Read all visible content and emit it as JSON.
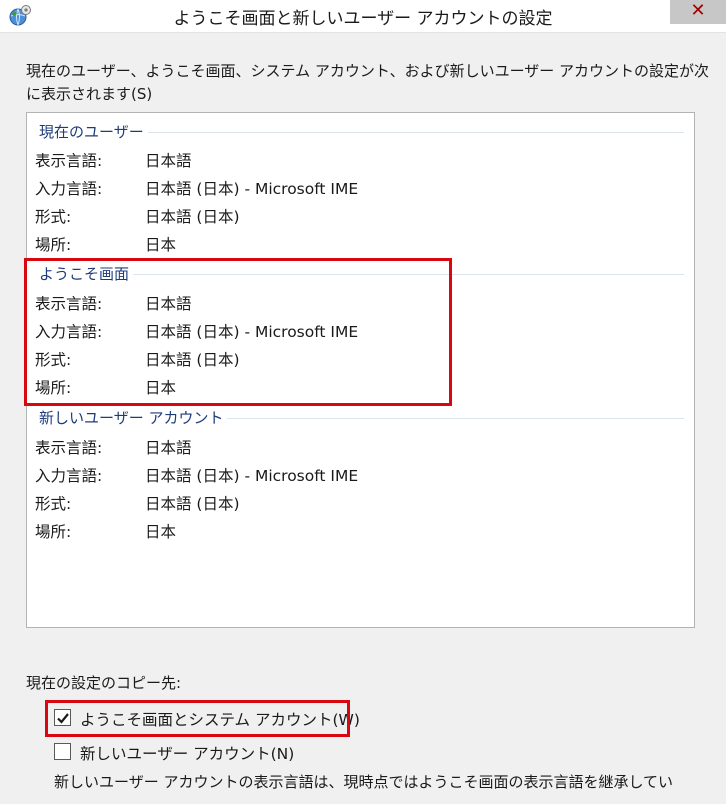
{
  "window": {
    "title": "ようこそ画面と新しいユーザー アカウントの設定",
    "close_glyph": "✕",
    "app_icon": "globe-settings-icon"
  },
  "description": "現在のユーザー、ようこそ画面、システム アカウント、および新しいユーザー アカウントの設定が次に表示されます(S)",
  "groups": [
    {
      "header": "現在のユーザー",
      "rows": [
        {
          "label": "表示言語:",
          "value": "日本語"
        },
        {
          "label": "入力言語:",
          "value": "日本語 (日本) - Microsoft IME"
        },
        {
          "label": "形式:",
          "value": "日本語 (日本)"
        },
        {
          "label": "場所:",
          "value": "日本"
        }
      ]
    },
    {
      "header": "ようこそ画面",
      "rows": [
        {
          "label": "表示言語:",
          "value": "日本語"
        },
        {
          "label": "入力言語:",
          "value": "日本語 (日本) - Microsoft IME"
        },
        {
          "label": "形式:",
          "value": "日本語 (日本)"
        },
        {
          "label": "場所:",
          "value": "日本"
        }
      ]
    },
    {
      "header": "新しいユーザー アカウント",
      "rows": [
        {
          "label": "表示言語:",
          "value": "日本語"
        },
        {
          "label": "入力言語:",
          "value": "日本語 (日本) - Microsoft IME"
        },
        {
          "label": "形式:",
          "value": "日本語 (日本)"
        },
        {
          "label": "場所:",
          "value": "日本"
        }
      ]
    }
  ],
  "copy_to_label": "現在の設定のコピー先:",
  "checkboxes": [
    {
      "label": "ようこそ画面とシステム アカウント(W)",
      "checked": true
    },
    {
      "label": "新しいユーザー アカウント(N)",
      "checked": false
    }
  ],
  "note": "新しいユーザー アカウントの表示言語は、現時点ではようこそ画面の表示言語を継承してい",
  "colors": {
    "highlight": "#d9070f",
    "group_header": "#1e3c7a"
  }
}
